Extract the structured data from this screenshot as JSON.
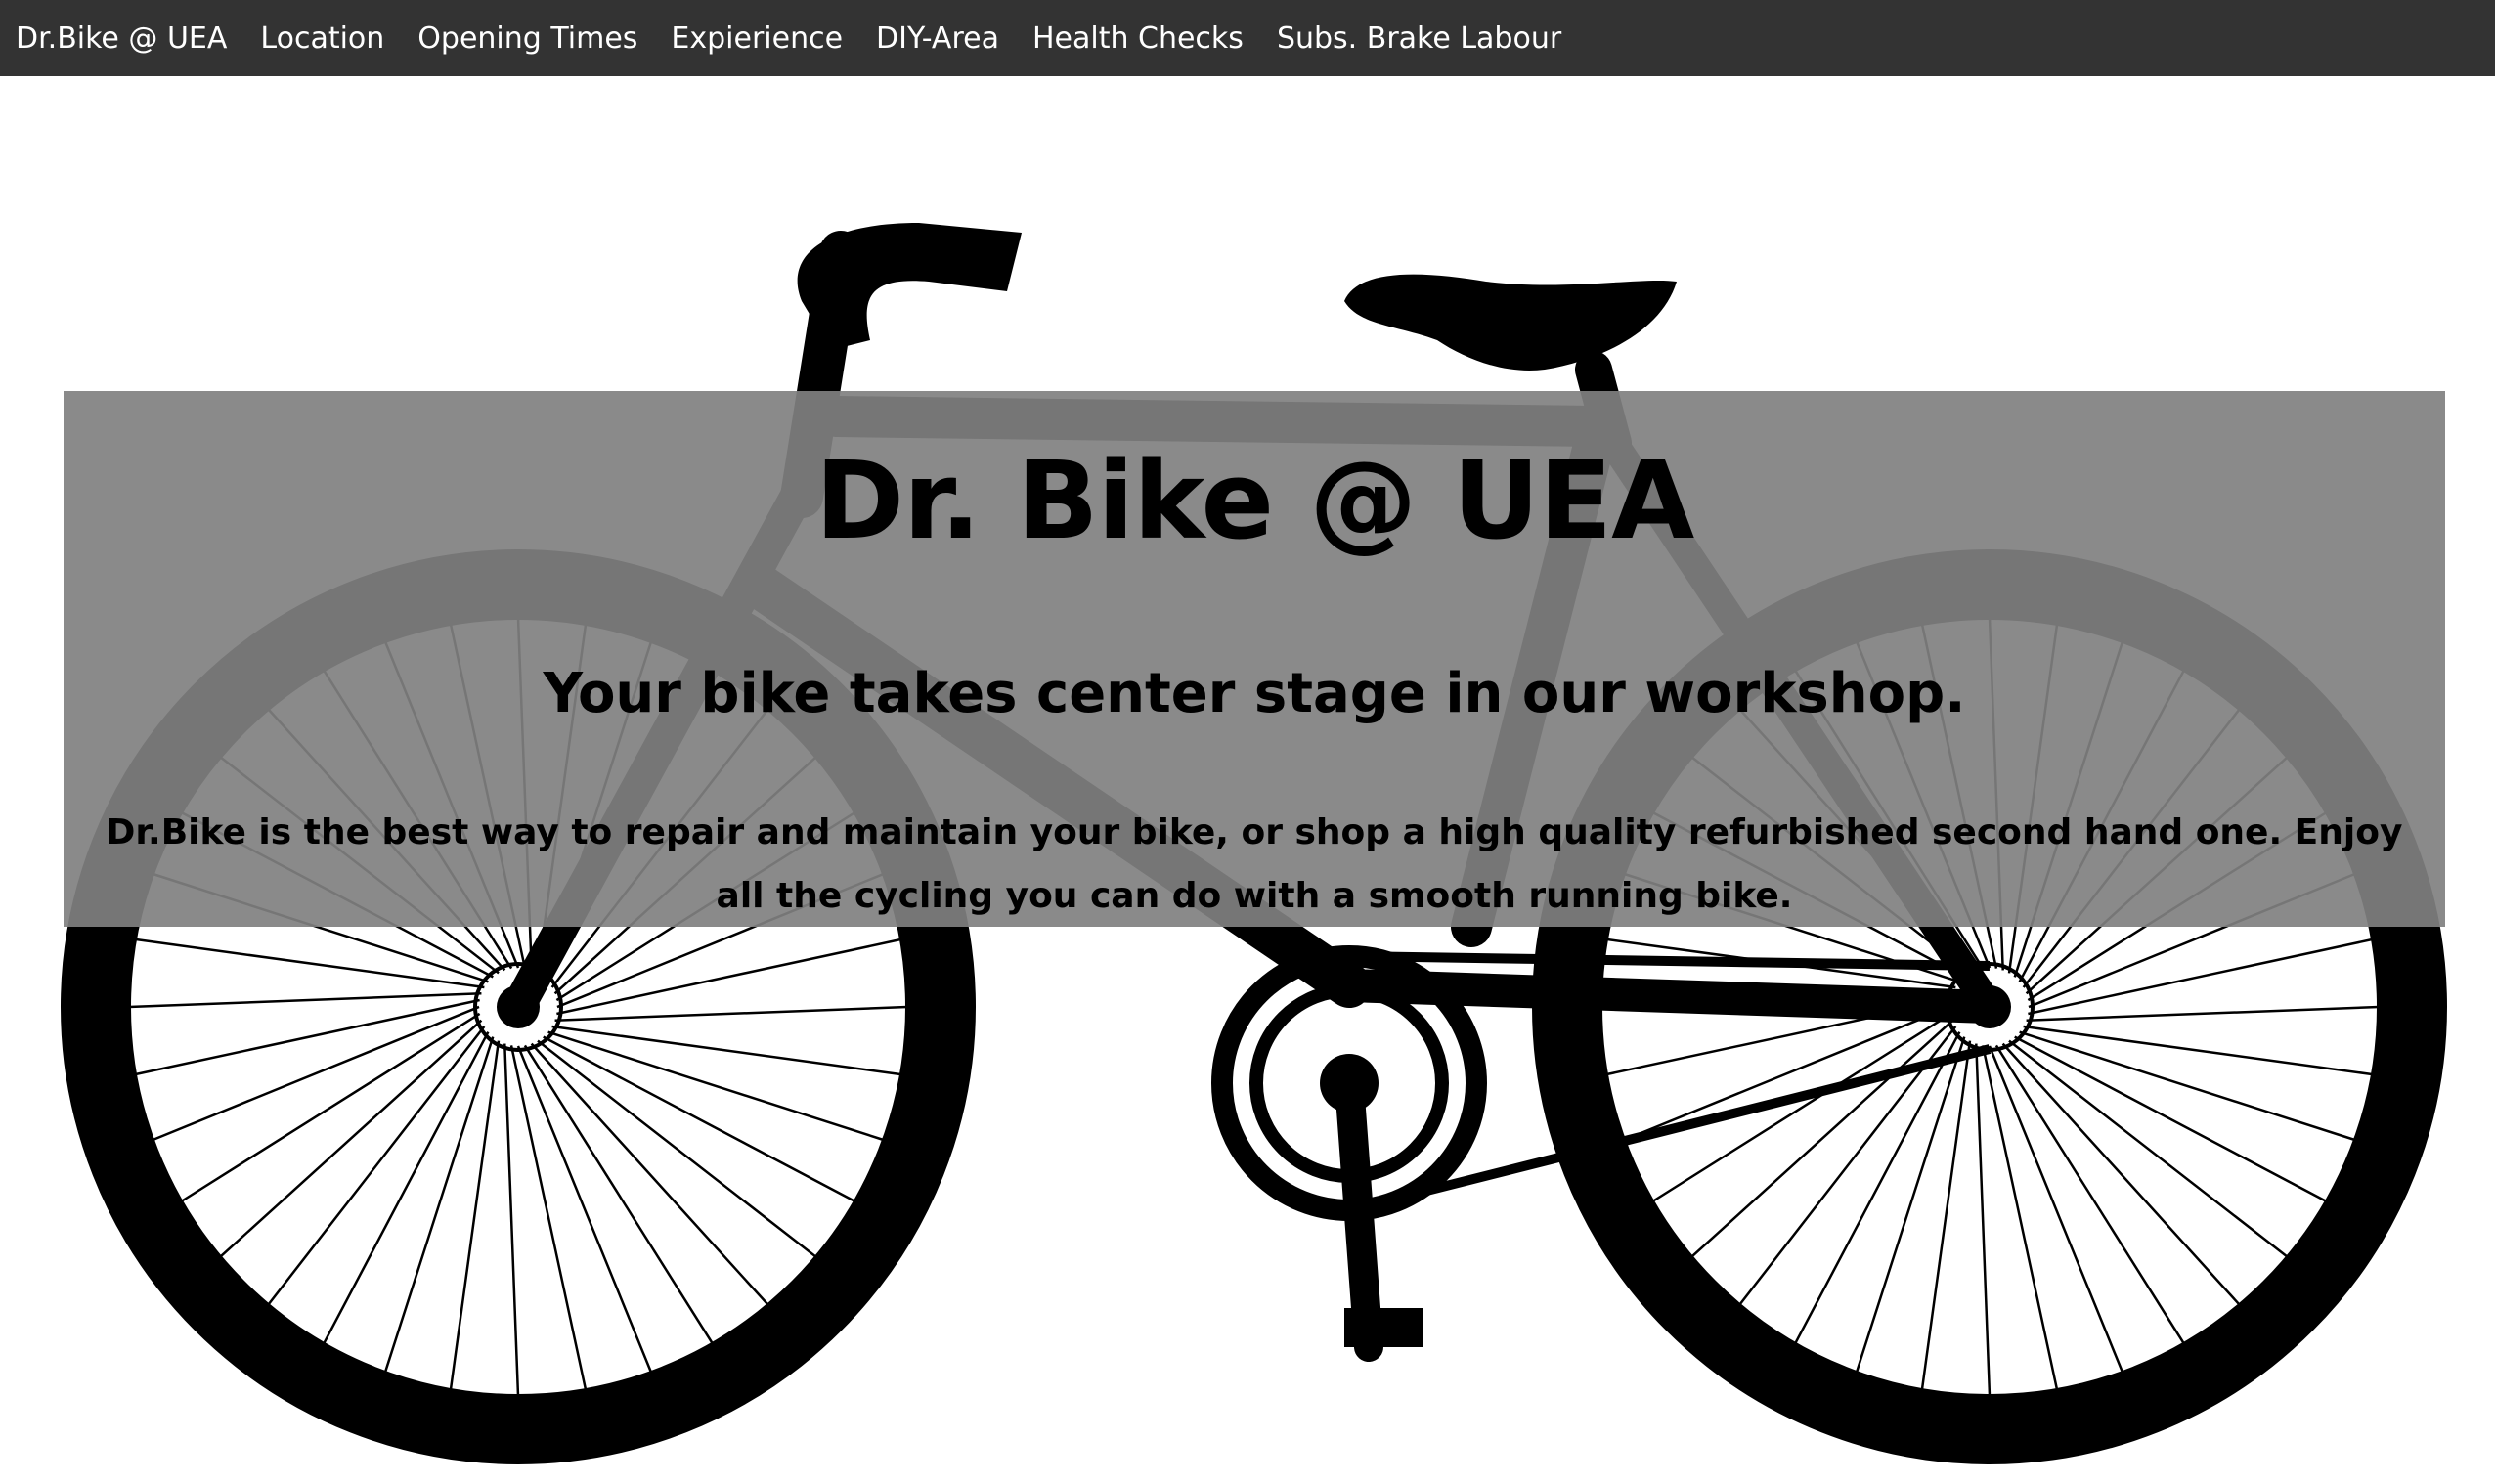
{
  "nav": {
    "brand": "Dr.Bike @ UEA",
    "items": [
      {
        "label": "Location"
      },
      {
        "label": "Opening Times"
      },
      {
        "label": "Expierience"
      },
      {
        "label": "DIY-Area"
      },
      {
        "label": "Health Checks"
      },
      {
        "label": "Subs. Brake Labour"
      }
    ]
  },
  "hero": {
    "title": "Dr. Bike @ UEA",
    "subtitle": "Your bike takes center stage in our workshop.",
    "description": "Dr.Bike is the best way to repair and maintain your bike, or shop a high quality refurbished second hand one. Enjoy all the cycling you can do with a smooth running bike."
  },
  "colors": {
    "navbar_bg": "#333333",
    "nav_text": "#ffffff",
    "overlay": "#808080",
    "bike": "#000000"
  },
  "background_image": "bicycle-silhouette"
}
